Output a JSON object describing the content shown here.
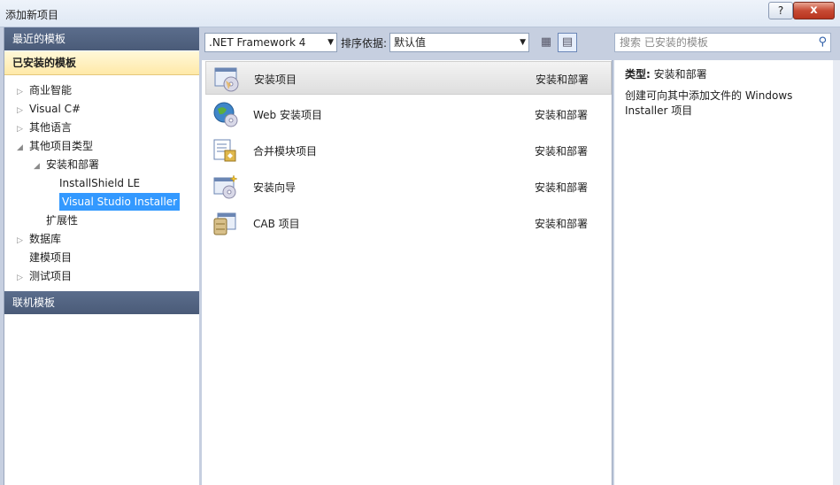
{
  "window": {
    "title": "添加新项目",
    "help": "?",
    "close": "x"
  },
  "left": {
    "recent_header": "最近的模板",
    "installed_header": "已安装的模板",
    "online_header": "联机模板",
    "tree": [
      {
        "label": "商业智能",
        "arrow": "▷"
      },
      {
        "label": "Visual C#",
        "arrow": "▷"
      },
      {
        "label": "其他语言",
        "arrow": "▷"
      },
      {
        "label": "其他项目类型",
        "arrow": "◢"
      },
      {
        "label": "安装和部署",
        "arrow": "◢"
      },
      {
        "label": "InstallShield LE",
        "arrow": ""
      },
      {
        "label": "Visual Studio Installer",
        "arrow": ""
      },
      {
        "label": "扩展性",
        "arrow": ""
      },
      {
        "label": "数据库",
        "arrow": "▷"
      },
      {
        "label": "建模项目",
        "arrow": ""
      },
      {
        "label": "测试项目",
        "arrow": "▷"
      }
    ]
  },
  "toolbar": {
    "framework": ".NET Framework 4",
    "sort_label": "排序依据:",
    "sort_value": "默认值",
    "view_small_icon": "list-view-icon",
    "view_details_icon": "details-view-icon"
  },
  "items": [
    {
      "name": "安装项目",
      "category": "安装和部署",
      "icon": "setup-project-icon"
    },
    {
      "name": "Web 安装项目",
      "category": "安装和部署",
      "icon": "web-setup-icon"
    },
    {
      "name": "合并模块项目",
      "category": "安装和部署",
      "icon": "merge-module-icon"
    },
    {
      "name": "安装向导",
      "category": "安装和部署",
      "icon": "setup-wizard-icon"
    },
    {
      "name": "CAB 项目",
      "category": "安装和部署",
      "icon": "cab-project-icon"
    }
  ],
  "search": {
    "placeholder": "搜索 已安装的模板"
  },
  "details": {
    "type_label": "类型:",
    "type_value": "安装和部署",
    "description": "创建可向其中添加文件的 Windows Installer 项目"
  }
}
